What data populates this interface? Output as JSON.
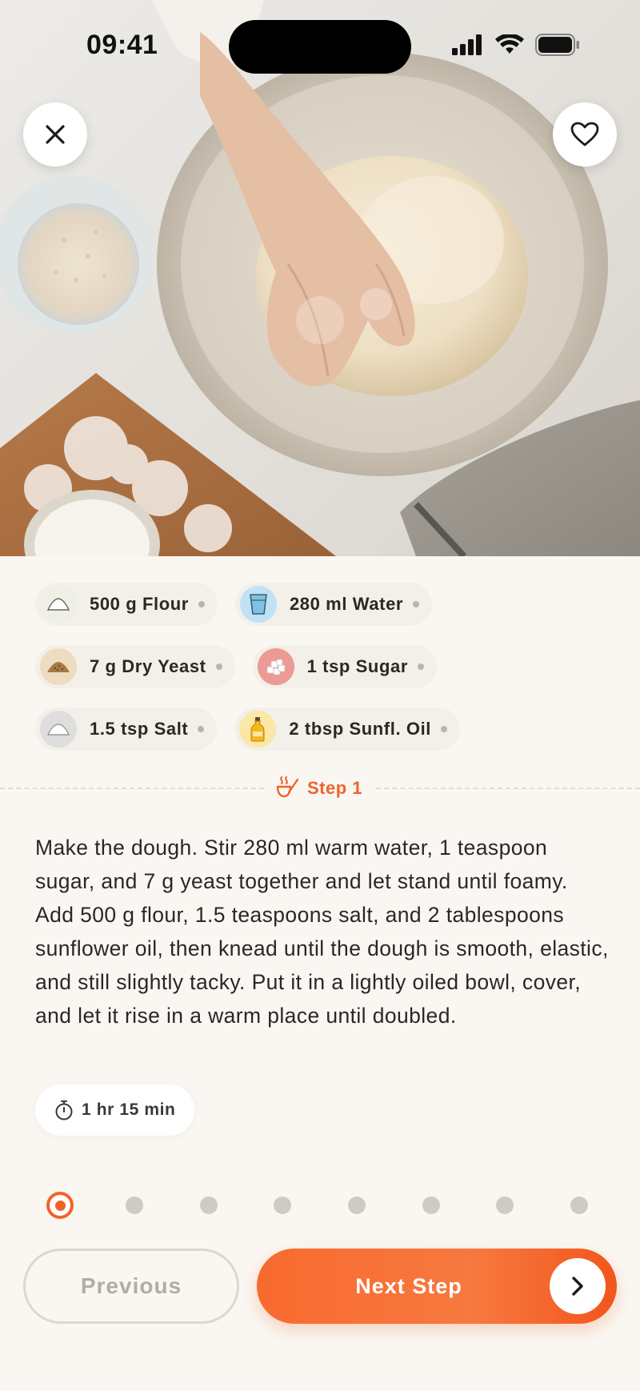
{
  "status_bar": {
    "time": "09:41"
  },
  "hero": {
    "image_subject": "hand kneading bread dough in a ceramic bowl"
  },
  "header_buttons": {
    "close_icon": "close-icon",
    "favorite_icon": "heart-icon"
  },
  "ingredients": [
    {
      "label": "500 g Flour",
      "icon": "flour-icon",
      "color": "#eef0e6"
    },
    {
      "label": "280 ml Water",
      "icon": "water-glass-icon",
      "color": "#bfe3f4"
    },
    {
      "label": "7 g Dry Yeast",
      "icon": "yeast-icon",
      "color": "#efdcc0"
    },
    {
      "label": "1 tsp Sugar",
      "icon": "sugar-icon",
      "color": "#ec9a93"
    },
    {
      "label": "1.5 tsp Salt",
      "icon": "salt-icon",
      "color": "#dedede"
    },
    {
      "label": "2 tbsp Sunfl. Oil",
      "icon": "oil-bottle-icon",
      "color": "#fbe7a6"
    }
  ],
  "step": {
    "title": "Step 1",
    "icon": "steaming-ladle-icon",
    "instruction": "Make the dough. Stir 280 ml warm water, 1 teaspoon sugar, and 7 g yeast together and let stand until foamy. Add 500 g flour, 1.5 teaspoons salt, and 2 tablespoons sunflower oil, then knead until the dough is smooth, elastic, and still slightly tacky. Put it in a lightly oiled bowl, cover, and let it rise in a warm place until doubled.",
    "timer": "1 hr 15 min"
  },
  "pagination": {
    "current": 1,
    "total": 8
  },
  "navigation": {
    "previous_label": "Previous",
    "next_label": "Next Step"
  },
  "colors": {
    "accent": "#f0642a",
    "background": "#faf7f2"
  }
}
